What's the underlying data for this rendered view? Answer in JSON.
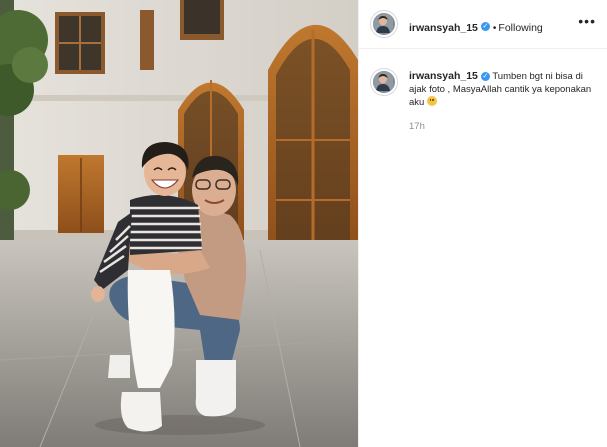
{
  "post": {
    "username": "irwansyah_15",
    "verified_badge": "verified-check-icon",
    "separator": "•",
    "follow_state": "Following",
    "more_icon": "•••",
    "caption_text": "Tumben bgt ni bisa di ajak foto , MasyaAllah cantik ya keponakan aku",
    "caption_emoji": "smiling-face-emoji",
    "timestamp": "17h"
  },
  "colors": {
    "accent_blue": "#3897f0",
    "muted_text": "#8e8e8e",
    "border": "#efefef"
  }
}
